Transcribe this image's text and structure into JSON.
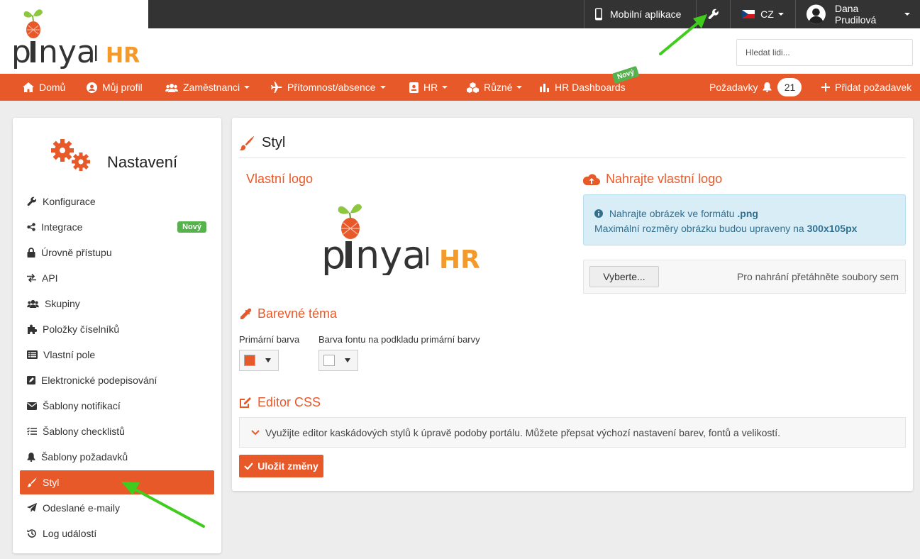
{
  "topbar": {
    "mobile_app": "Mobilní aplikace",
    "language": "CZ",
    "user_name": "Dana Prudilová"
  },
  "brand": {
    "name": "pinya",
    "suffix": "HR"
  },
  "search": {
    "placeholder": "Hledat lidi..."
  },
  "nav": {
    "items": [
      {
        "label": "Domů"
      },
      {
        "label": "Můj profil"
      },
      {
        "label": "Zaměstnanci"
      },
      {
        "label": "Přítomnost/absence"
      },
      {
        "label": "HR"
      },
      {
        "label": "Různé"
      },
      {
        "label": "HR Dashboards"
      }
    ],
    "new_badge": "Nový",
    "requests_label": "Požadavky",
    "requests_count": "21",
    "add_request": "Přidat požadavek"
  },
  "sidebar": {
    "title": "Nastavení",
    "new_badge": "Nový",
    "items": [
      {
        "label": "Konfigurace"
      },
      {
        "label": "Integrace"
      },
      {
        "label": "Úrovně přístupu"
      },
      {
        "label": "API"
      },
      {
        "label": "Skupiny"
      },
      {
        "label": "Položky číselníků"
      },
      {
        "label": "Vlastní pole"
      },
      {
        "label": "Elektronické podepisování"
      },
      {
        "label": "Šablony notifikací"
      },
      {
        "label": "Šablony checklistů"
      },
      {
        "label": "Šablony požadavků"
      },
      {
        "label": "Styl"
      },
      {
        "label": "Odeslané e-maily"
      },
      {
        "label": "Log událostí"
      }
    ]
  },
  "main": {
    "title": "Styl",
    "custom_logo": "Vlastní logo",
    "upload_title": "Nahrajte vlastní logo",
    "info_line1_prefix": "Nahrajte obrázek ve formátu",
    "info_line1_format": ".png",
    "info_line2_prefix": "Maximální rozměry obrázku budou upraveny na",
    "info_line2_size": "300x105px",
    "choose_button": "Vyberte...",
    "drop_hint": "Pro nahrání přetáhněte soubory sem",
    "theme_title": "Barevné téma",
    "primary_color_label": "Primární barva",
    "font_color_label": "Barva fontu na podkladu primární barvy",
    "primary_color": "#e8592a",
    "font_color": "#ffffff",
    "css_title": "Editor CSS",
    "css_hint": "Využijte editor kaskádových stylů k úpravě podoby portálu. Můžete přepsat výchozí nastavení barev, fontů a velikostí.",
    "save_button": "Uložit změny"
  },
  "colors": {
    "accent": "#e8592a",
    "success": "#55b24c",
    "dark": "#333333"
  }
}
